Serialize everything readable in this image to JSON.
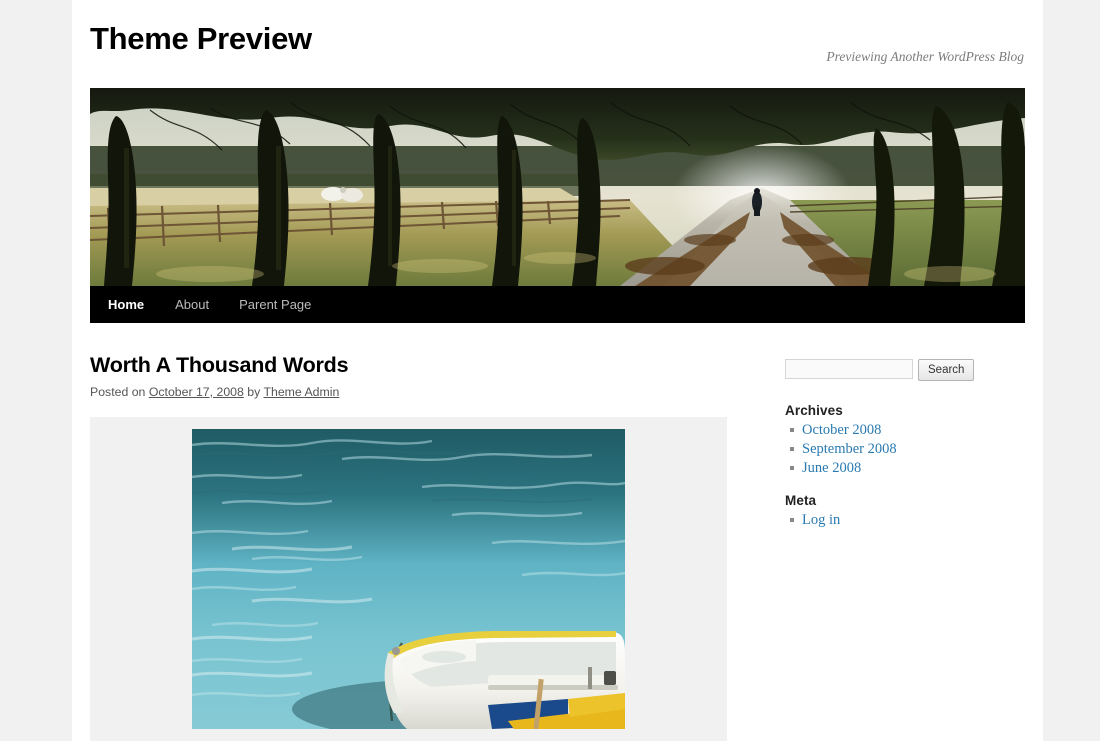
{
  "page": {
    "background_color": "#f1f1f1",
    "sheet_color": "#ffffff"
  },
  "header": {
    "site_title": "Theme Preview",
    "site_description": "Previewing Another WordPress Blog",
    "header_image_alt": "tree-lined-path-header-image"
  },
  "nav": {
    "items": [
      {
        "label": "Home",
        "current": true
      },
      {
        "label": "About",
        "current": false
      },
      {
        "label": "Parent Page",
        "current": false
      }
    ]
  },
  "post": {
    "title": "Worth A Thousand Words",
    "meta_prefix": "Posted on",
    "date": "October 17, 2008",
    "meta_by": "by",
    "author": "Theme Admin",
    "gallery_image_alt": "white-and-yellow-rowboat-on-teal-water"
  },
  "sidebar": {
    "search": {
      "value": "",
      "placeholder": "",
      "button_label": "Search",
      "icon": "search-icon"
    },
    "widgets": [
      {
        "title": "Archives",
        "items": [
          {
            "label": "October 2008"
          },
          {
            "label": "September 2008"
          },
          {
            "label": "June 2008"
          }
        ]
      },
      {
        "title": "Meta",
        "items": [
          {
            "label": "Log in"
          }
        ]
      }
    ]
  },
  "colors": {
    "link": "#2a7ab0",
    "nav_bg": "#000000",
    "nav_inactive": "#bbbbbb",
    "nav_active": "#ffffff",
    "meta_text": "#555555",
    "tagline": "#7c7c7c",
    "gallery_bg": "#f1f1f1"
  }
}
